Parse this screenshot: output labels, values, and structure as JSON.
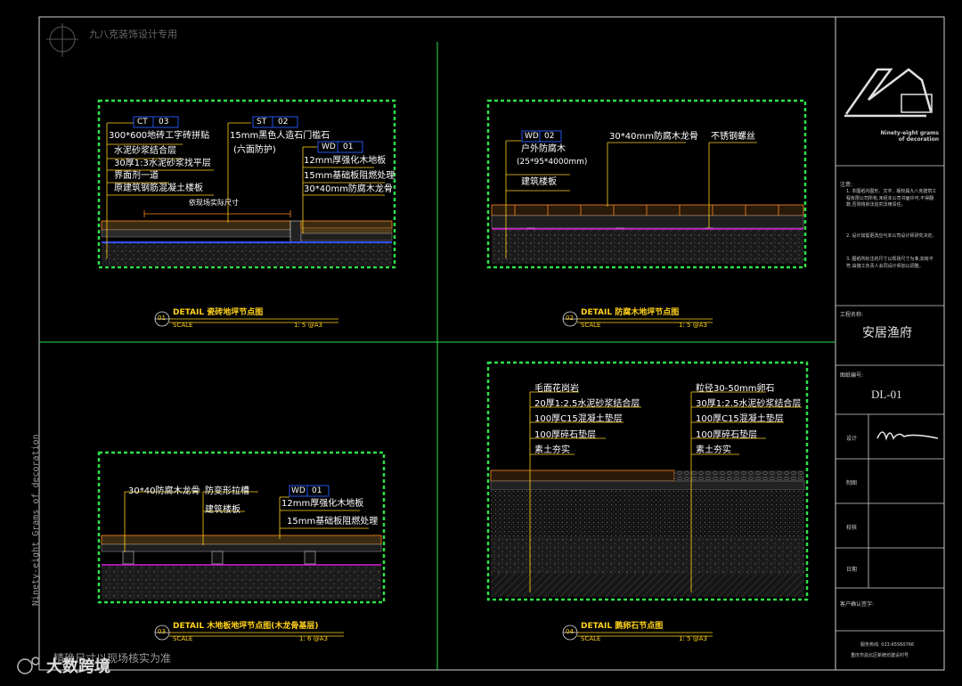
{
  "header": {
    "watermark": "九八克装饰设计专用",
    "side_text": "Ninety-eight Grams of decoration"
  },
  "footer": {
    "note": "精确尺寸以现场核实为准",
    "brand": "大数跨境"
  },
  "title_block": {
    "brand_name": "Ninety-eight grams\nof decoration",
    "notes_title": "注意:",
    "notes": [
      "1. 本图纸内图形、文字、版权属九八克建筑工程有限公司所有,未经本公司书面许可,不得翻数,否则将依法追究法律责任。",
      "2. 设计如需更改应与本公司设计师研究决定。",
      "3. 图纸所标注的尺寸以现场尺寸为准,如有不符,由施工负责人会同设计师加以调整。"
    ],
    "project_label": "工程名称:",
    "project_name": "安居渔府",
    "drawing_no_label": "图纸编号:",
    "drawing_no": "DL-01",
    "design_label": "设计",
    "draw_label": "制图",
    "check_label": "校核",
    "date_label": "日期",
    "client_label": "客户确认签字:",
    "phone": "服务热线: 023-65560766",
    "address": "重庆市渝北区新牌坊建设村号"
  },
  "details": [
    {
      "num": "01",
      "title": "DETAIL  瓷砖地坪节点图",
      "scale_label": "SCALE",
      "scale": "1: 5 @A3",
      "tags": [
        {
          "code": "CT",
          "num": "03"
        },
        {
          "code": "ST",
          "num": "02"
        },
        {
          "code": "WD",
          "num": "01"
        }
      ],
      "labels_left": [
        "300*600地砖工字砖拼贴",
        "水泥砂浆结合层",
        "30厚1:3水泥砂浆找平层",
        "界面剂一道",
        "原建筑钢筋混凝土楼板"
      ],
      "labels_mid": [
        "15mm黑色人造石门槛石",
        "(六面防护)"
      ],
      "labels_right": [
        "12mm厚强化木地板",
        "15mm基础板阻燃处理",
        "30*40mm防腐木龙骨"
      ],
      "dim_note": "依现场实际尺寸"
    },
    {
      "num": "02",
      "title": "DETAIL  防腐木地坪节点图",
      "scale_label": "SCALE",
      "scale": "1: 5 @A3",
      "tags": [
        {
          "code": "WD",
          "num": "02"
        }
      ],
      "labels": [
        "户外防腐木",
        "(25*95*4000mm)",
        "建筑楼板",
        "30*40mm防腐木龙骨",
        "不锈钢螺丝"
      ]
    },
    {
      "num": "03",
      "title": "DETAIL  木地板地坪节点图(木龙骨基层)",
      "scale_label": "SCALE",
      "scale": "1: 6 @A3",
      "tags": [
        {
          "code": "WD",
          "num": "01"
        }
      ],
      "labels": [
        "30*40防腐木龙骨",
        "防变形拉槽",
        "建筑楼板",
        "12mm厚强化木地板",
        "15mm基础板阻燃处理"
      ]
    },
    {
      "num": "04",
      "title": "DETAIL  鹅卵石节点图",
      "scale_label": "SCALE",
      "scale": "1: 5 @A3",
      "labels_left": [
        "毛面花岗岩",
        "20厚1:2.5水泥砂浆结合层",
        "100厚C15混凝土垫层",
        "100厚碎石垫层",
        "素土夯实"
      ],
      "labels_right": [
        "粒径30-50mm卵石",
        "30厚1:2.5水泥砂浆结合层",
        "100厚C15混凝土垫层",
        "100厚碎石垫层",
        "素土夯实"
      ]
    }
  ],
  "colors": {
    "frame": "#cfcfcf",
    "divider": "#2ee04a",
    "leader": "#ffd21a",
    "wood": "#ff8a1e",
    "membrane": "#e020e0",
    "tag": "#2a5cff"
  }
}
